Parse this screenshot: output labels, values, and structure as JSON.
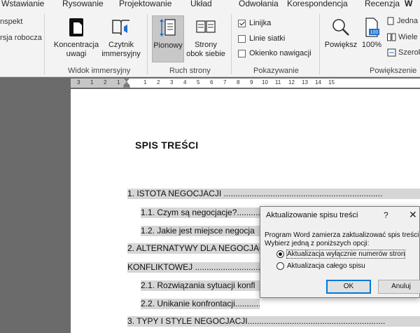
{
  "tabs": [
    "Wstawianie",
    "Rysowanie",
    "Projektowanie",
    "Układ",
    "Odwołania",
    "Korespondencja",
    "Recenzja",
    "W"
  ],
  "ribbon": {
    "left_items": [
      "nspekt",
      "rsja robocza"
    ],
    "immersive": {
      "focus_label": [
        "Koncentracja",
        "uwagi"
      ],
      "reader_label": [
        "Czytnik",
        "immersyjny"
      ],
      "group_label": "Widok immersyjny"
    },
    "movement": {
      "vertical_label": "Pionowy",
      "side_label": [
        "Strony",
        "obok siebie"
      ],
      "group_label": "Ruch strony"
    },
    "show": {
      "ruler": "Linijka",
      "gridlines": "Linie siatki",
      "nav_pane": "Okienko nawigacji",
      "group_label": "Pokazywanie",
      "ruler_checked": true,
      "gridlines_checked": false,
      "nav_pane_checked": false
    },
    "zoom": {
      "zoom_label": "Powiększ",
      "hundred_label": "100%",
      "one_page": "Jedna s",
      "multi_page": "Wiele s",
      "page_width": "Szerok",
      "group_label": "Powiększenie",
      "icon_text": "100"
    }
  },
  "ruler": {
    "numbers": [
      "3",
      "1",
      "2",
      "1",
      "1",
      "2",
      "3",
      "4",
      "5",
      "6",
      "7",
      "8",
      "9",
      "10",
      "11",
      "12",
      "13",
      "14",
      "15"
    ]
  },
  "document": {
    "toc_title": "SPIS TREŚCI",
    "entries": [
      "1. ISTOTA NEGOCJACJI ....................................................................",
      "1.1. Czym są negocjacje?.....................................",
      "1.2. Jakie jest miejsce negocja",
      "2. ALTERNATYWY DLA NEGOCJAC",
      "KONFLIKTOWEJ ...........................................",
      "2.1. Rozwiązania sytuacji konfl",
      "2.2. Unikanie konfrontacji..........................................",
      "3. TYPY I STYLE NEGOCJACJI..........................................................."
    ]
  },
  "dialog": {
    "title": "Aktualizowanie spisu treści",
    "help": "?",
    "close": "✕",
    "message_line1": "Program Word zamierza zaktualizować spis treści",
    "message_line2": "Wybierz jedną z poniższych opcji:",
    "option1": "Aktualizacja wyłącznie numerów stron",
    "option2": "Aktualizacja całego spisu",
    "selected_option": 1,
    "ok_label": "OK",
    "cancel_label": "Anuluj"
  }
}
